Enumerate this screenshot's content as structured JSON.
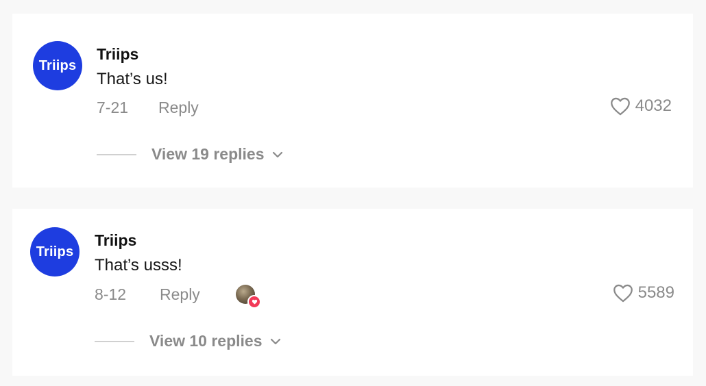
{
  "comments": [
    {
      "avatar_text": "Triips",
      "username": "Triips",
      "text": "That’s us!",
      "date": "7-21",
      "reply_label": "Reply",
      "likes": "4032",
      "view_replies_label": "View 19 replies"
    },
    {
      "avatar_text": "Triips",
      "username": "Triips",
      "text": "That’s usss!",
      "date": "8-12",
      "reply_label": "Reply",
      "likes": "5589",
      "view_replies_label": "View 10 replies",
      "creator_liked": true
    }
  ],
  "colors": {
    "avatar_bg": "#1e3de0",
    "background": "#f8f8f8",
    "muted_text": "#8a8a8a",
    "heart_badge": "#f23a58"
  },
  "icons": {
    "like": "heart-outline-icon",
    "expand": "chevron-down-icon",
    "creator_like": "heart-badge-icon"
  }
}
